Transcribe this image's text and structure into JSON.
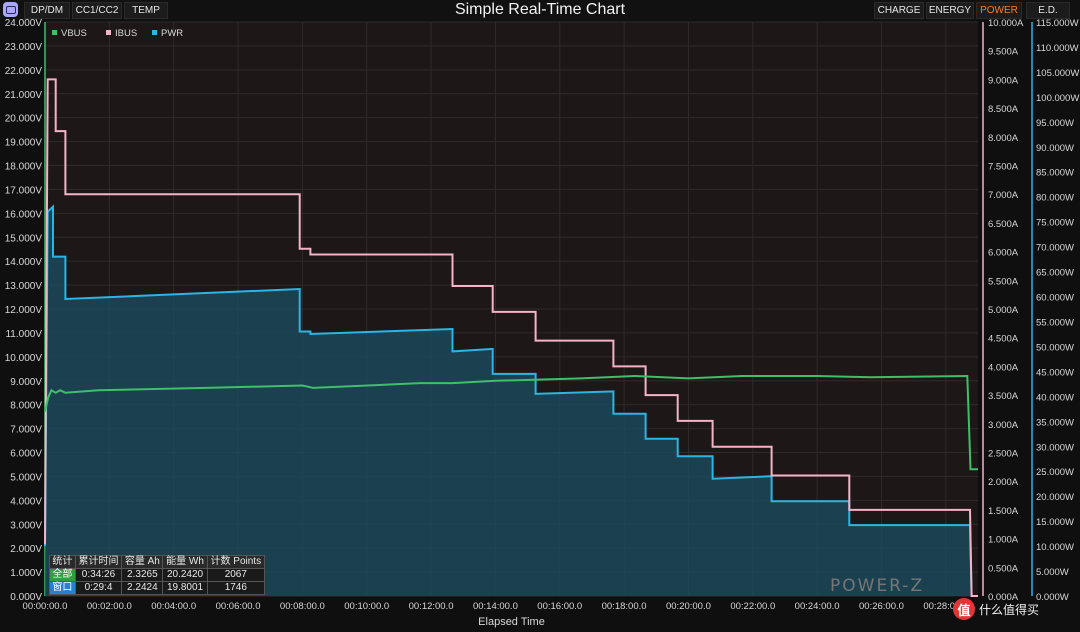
{
  "header": {
    "title": "Simple Real-Time Chart",
    "left_tabs": [
      "DP/DM",
      "CC1/CC2",
      "TEMP"
    ],
    "right_tabs": [
      "CHARGE",
      "ENERGY",
      "POWER",
      "E.D."
    ],
    "active_tab": "POWER"
  },
  "colors": {
    "vbus": "#3fbf6a",
    "ibus": "#f4b3c6",
    "pwr": "#29b6e6",
    "active_tab": "#ff7a1a"
  },
  "stats_table": {
    "headers": [
      "统计",
      "累计时间",
      "容量 Ah",
      "能量 Wh",
      "计数 Points"
    ],
    "rows": [
      [
        "全部",
        "0:34:26",
        "2.3265",
        "20.2420",
        "2067"
      ],
      [
        "窗口",
        "0:29:4",
        "2.2424",
        "19.8001",
        "1746"
      ]
    ]
  },
  "watermark": "POWER-Z",
  "site_badge": {
    "logo": "值",
    "text": "什么值得买"
  },
  "chart_data": {
    "type": "line",
    "xlabel": "Elapsed Time",
    "x_ticks": [
      "00:00:00.0",
      "00:02:00.0",
      "00:04:00.0",
      "00:06:00.0",
      "00:08:00.0",
      "00:10:00.0",
      "00:12:00.0",
      "00:14:00.0",
      "00:16:00.0",
      "00:18:00.0",
      "00:20:00.0",
      "00:22:00.0",
      "00:24:00.0",
      "00:26:00.0",
      "00:28:00.0"
    ],
    "xlim_seconds": [
      0,
      1740
    ],
    "left_axis": {
      "unit": "V",
      "ylim": [
        0,
        24
      ],
      "ticks": [
        "0.000V",
        "1.000V",
        "2.000V",
        "3.000V",
        "4.000V",
        "5.000V",
        "6.000V",
        "7.000V",
        "8.000V",
        "9.000V",
        "10.000V",
        "11.000V",
        "12.000V",
        "13.000V",
        "14.000V",
        "15.000V",
        "16.000V",
        "17.000V",
        "18.000V",
        "19.000V",
        "20.000V",
        "21.000V",
        "22.000V",
        "23.000V",
        "24.000V"
      ]
    },
    "right_axis_1": {
      "unit": "A",
      "ylim": [
        0,
        10
      ],
      "ticks": [
        "0.000A",
        "0.500A",
        "1.000A",
        "1.500A",
        "2.000A",
        "2.500A",
        "3.000A",
        "3.500A",
        "4.000A",
        "4.500A",
        "5.000A",
        "5.500A",
        "6.000A",
        "6.500A",
        "7.000A",
        "7.500A",
        "8.000A",
        "8.500A",
        "9.000A",
        "9.500A",
        "10.000A"
      ]
    },
    "right_axis_2": {
      "unit": "W",
      "ylim": [
        0,
        115
      ],
      "ticks": [
        "0.000W",
        "5.000W",
        "10.000W",
        "15.000W",
        "20.000W",
        "25.000W",
        "30.000W",
        "35.000W",
        "40.000W",
        "45.000W",
        "50.000W",
        "55.000W",
        "60.000W",
        "65.000W",
        "70.000W",
        "75.000W",
        "80.000W",
        "85.000W",
        "90.000W",
        "95.000W",
        "100.000W",
        "105.000W",
        "110.000W",
        "115.000W"
      ]
    },
    "legend": [
      "VBUS",
      "IBUS",
      "PWR"
    ],
    "series": [
      {
        "name": "VBUS",
        "axis": "V",
        "points": [
          [
            0,
            7.7
          ],
          [
            6,
            8.3
          ],
          [
            12,
            8.6
          ],
          [
            20,
            8.5
          ],
          [
            28,
            8.6
          ],
          [
            38,
            8.5
          ],
          [
            100,
            8.6
          ],
          [
            300,
            8.7
          ],
          [
            480,
            8.8
          ],
          [
            500,
            8.7
          ],
          [
            700,
            8.9
          ],
          [
            760,
            8.9
          ],
          [
            840,
            9.0
          ],
          [
            1000,
            9.1
          ],
          [
            1100,
            9.2
          ],
          [
            1200,
            9.1
          ],
          [
            1300,
            9.2
          ],
          [
            1440,
            9.2
          ],
          [
            1540,
            9.15
          ],
          [
            1720,
            9.2
          ],
          [
            1726,
            5.3
          ],
          [
            1740,
            5.3
          ]
        ]
      },
      {
        "name": "IBUS",
        "axis": "A",
        "points": [
          [
            0,
            0.9
          ],
          [
            5,
            9.0
          ],
          [
            20,
            9.0
          ],
          [
            20,
            8.1
          ],
          [
            38,
            8.1
          ],
          [
            38,
            7.0
          ],
          [
            475,
            7.0
          ],
          [
            475,
            6.05
          ],
          [
            495,
            6.05
          ],
          [
            495,
            5.95
          ],
          [
            760,
            5.95
          ],
          [
            760,
            5.4
          ],
          [
            835,
            5.4
          ],
          [
            835,
            4.95
          ],
          [
            915,
            4.95
          ],
          [
            915,
            4.45
          ],
          [
            1060,
            4.45
          ],
          [
            1060,
            4.0
          ],
          [
            1120,
            4.0
          ],
          [
            1120,
            3.5
          ],
          [
            1180,
            3.5
          ],
          [
            1180,
            3.05
          ],
          [
            1245,
            3.05
          ],
          [
            1245,
            2.6
          ],
          [
            1355,
            2.6
          ],
          [
            1355,
            2.1
          ],
          [
            1500,
            2.1
          ],
          [
            1500,
            1.5
          ],
          [
            1725,
            1.5
          ],
          [
            1728,
            0.0
          ],
          [
            1740,
            0.0
          ]
        ]
      },
      {
        "name": "PWR",
        "axis": "W",
        "points": [
          [
            0,
            10
          ],
          [
            5,
            77
          ],
          [
            15,
            78
          ],
          [
            15,
            68
          ],
          [
            38,
            68
          ],
          [
            38,
            59.5
          ],
          [
            475,
            61.5
          ],
          [
            475,
            53
          ],
          [
            495,
            53
          ],
          [
            495,
            52.5
          ],
          [
            760,
            53.5
          ],
          [
            760,
            49
          ],
          [
            835,
            49.5
          ],
          [
            835,
            44.5
          ],
          [
            915,
            44.5
          ],
          [
            915,
            40.5
          ],
          [
            1060,
            41
          ],
          [
            1060,
            36.5
          ],
          [
            1120,
            36.5
          ],
          [
            1120,
            31.5
          ],
          [
            1180,
            31.5
          ],
          [
            1180,
            28
          ],
          [
            1245,
            28
          ],
          [
            1245,
            23.5
          ],
          [
            1355,
            24
          ],
          [
            1355,
            19
          ],
          [
            1500,
            19
          ],
          [
            1500,
            14.2
          ],
          [
            1725,
            14.2
          ],
          [
            1728,
            0.0
          ],
          [
            1740,
            0.0
          ]
        ]
      }
    ]
  }
}
